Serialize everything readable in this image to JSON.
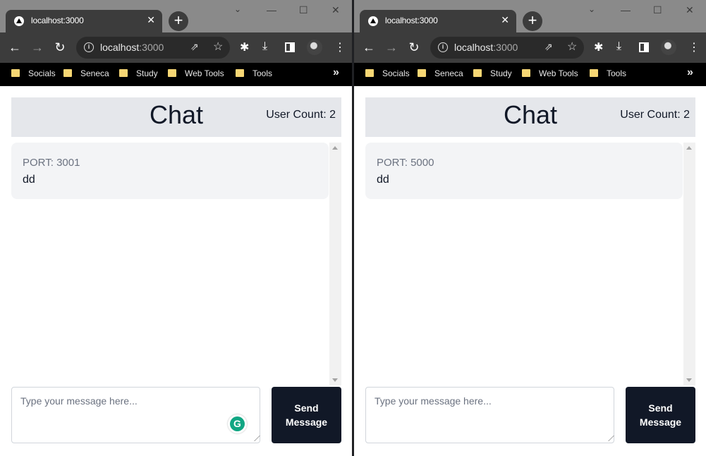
{
  "windows": [
    {
      "tab": {
        "title": "localhost:3000",
        "close": "✕"
      },
      "toolbar": {
        "url_host": "localhost",
        "url_port": ":3000"
      },
      "bookmarks": [
        "Socials",
        "Seneca",
        "Study",
        "Web Tools",
        "Tools"
      ],
      "bookmarks_more": "»",
      "chat": {
        "title": "Chat",
        "user_count": "User Count: 2",
        "messages": [
          {
            "port": "PORT: 3001",
            "text": "dd"
          }
        ],
        "input_placeholder": "Type your message here...",
        "send_label": "Send\nMessage",
        "grammarly_badge": "G"
      }
    },
    {
      "tab": {
        "title": "localhost:3000",
        "close": "✕"
      },
      "toolbar": {
        "url_host": "localhost",
        "url_port": ":3000"
      },
      "bookmarks": [
        "Socials",
        "Seneca",
        "Study",
        "Web Tools",
        "Tools"
      ],
      "bookmarks_more": "»",
      "chat": {
        "title": "Chat",
        "user_count": "User Count: 2",
        "messages": [
          {
            "port": "PORT: 5000",
            "text": "dd"
          }
        ],
        "input_placeholder": "Type your message here...",
        "send_label": "Send\nMessage"
      }
    }
  ],
  "icons": {
    "new_tab": "+",
    "chevron": "⌄",
    "minimize": "—",
    "maximize": "☐",
    "close": "✕",
    "back": "←",
    "forward": "→",
    "reload": "↻",
    "star": "☆",
    "share": "⇗",
    "extensions": "✱",
    "download": "⤓",
    "menu": "⋮",
    "info": "i"
  }
}
